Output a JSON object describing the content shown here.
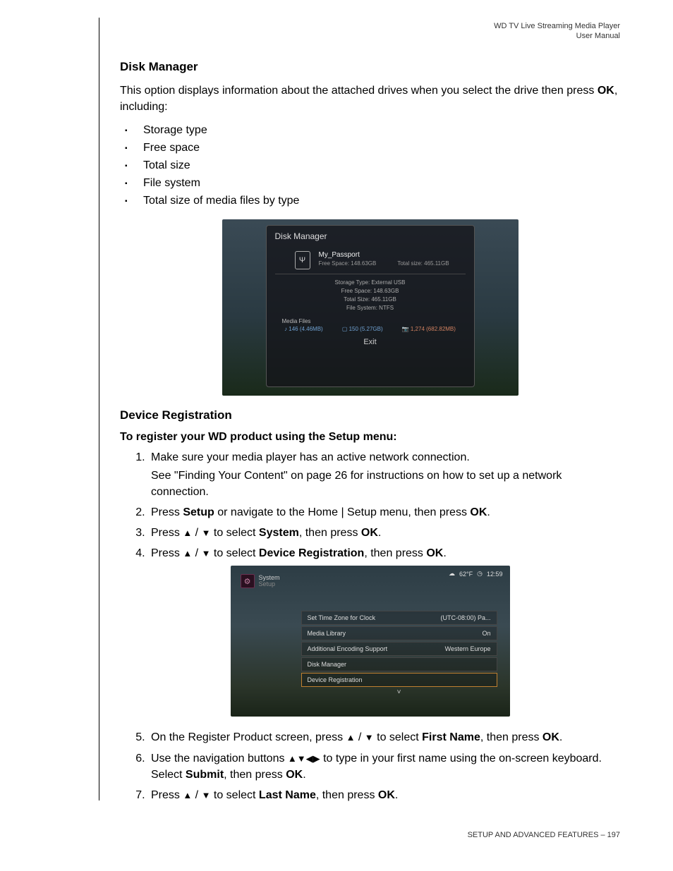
{
  "header": {
    "line1": "WD TV Live Streaming Media Player",
    "line2": "User Manual"
  },
  "section1": {
    "title": "Disk Manager",
    "intro_a": "This option displays information about the attached drives when you select the drive then press ",
    "intro_ok": "OK",
    "intro_b": ", including:",
    "bullets": [
      "Storage type",
      "Free space",
      "Total size",
      "File system",
      "Total size of media files by type"
    ]
  },
  "dm_screenshot": {
    "title": "Disk Manager",
    "usb_glyph": "⎙",
    "drive_name": "My_Passport",
    "free_label": "Free Space: 148.63GB",
    "total_label": "Total size: 465.11GB",
    "d1": "Storage Type: External USB",
    "d2": "Free Space: 148.63GB",
    "d3": "Total Size: 465.11GB",
    "d4": "File System: NTFS",
    "media_label": "Media Files",
    "m1": "♪ 146 (4.46MB)",
    "m2": "▢ 150 (5.27GB)",
    "m3": "📷 1,274 (682.82MB)",
    "exit": "Exit"
  },
  "section2": {
    "title": "Device Registration",
    "sub": "To register your WD product using the Setup menu:"
  },
  "steps_a": {
    "s1a": "Make sure your media player has an active network connection.",
    "s1b": "See \"Finding Your Content\" on page 26 for instructions on how to set up a network connection.",
    "s2a": "Press ",
    "s2_setup": "Setup",
    "s2b": " or navigate to the Home | Setup menu, then press ",
    "s2_ok": "OK",
    "s2c": ".",
    "s3a": "Press ",
    "s3b": " to select ",
    "s3_system": "System",
    "s3c": ", then press ",
    "s3_ok": "OK",
    "s3d": ".",
    "s4a": "Press ",
    "s4b": " to select ",
    "s4_dr": "Device Registration",
    "s4c": ", then press ",
    "s4_ok": "OK",
    "s4d": "."
  },
  "setup_screenshot": {
    "cloud": "☁",
    "temp": "62°F",
    "clock_icon": "◷",
    "time": "12:59",
    "gear": "⚙",
    "crumb1": "System",
    "crumb2": "Setup",
    "items": [
      {
        "l": "Set Time Zone for Clock",
        "r": "(UTC-08:00) Pa..."
      },
      {
        "l": "Media Library",
        "r": "On"
      },
      {
        "l": "Additional Encoding Support",
        "r": "Western Europe"
      },
      {
        "l": "Disk Manager",
        "r": ""
      },
      {
        "l": "Device Registration",
        "r": ""
      }
    ],
    "arrow": "˅"
  },
  "steps_b": {
    "s5a": "On the Register Product screen, press ",
    "s5b": " to select ",
    "s5_fn": "First Name",
    "s5c": ", then press ",
    "s5_ok": "OK",
    "s5d": ".",
    "s6a": "Use the navigation buttons ",
    "s6b": " to type in your first name using the on-screen keyboard. Select ",
    "s6_submit": "Submit",
    "s6c": ", then press ",
    "s6_ok": "OK",
    "s6d": ".",
    "s7a": "Press ",
    "s7b": " to select ",
    "s7_ln": "Last Name",
    "s7c": ", then press ",
    "s7_ok": "OK",
    "s7d": "."
  },
  "icons": {
    "up": "▲",
    "down": "▼",
    "left": "◀",
    "right": "▶",
    "slash": " / "
  },
  "footer": {
    "text": "SETUP AND ADVANCED FEATURES – 197"
  }
}
